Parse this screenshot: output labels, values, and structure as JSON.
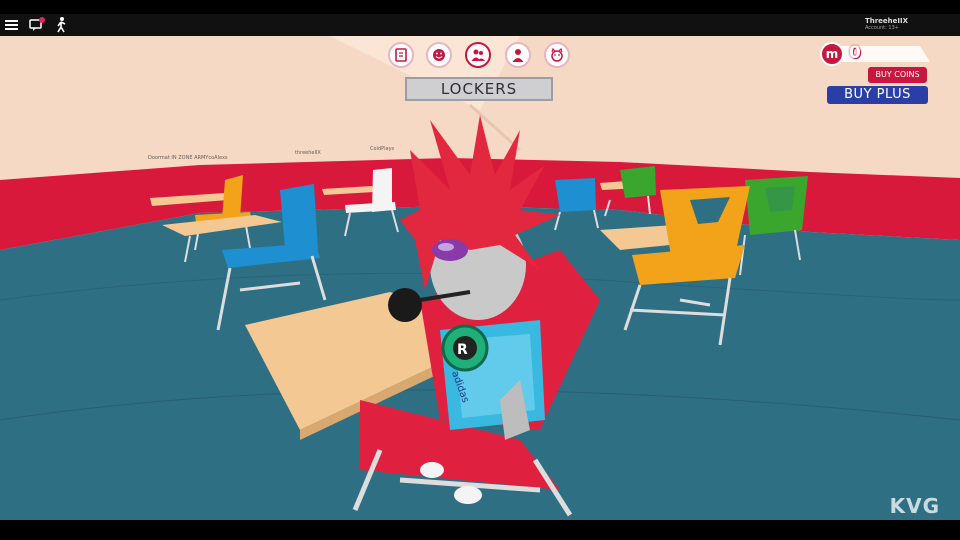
{
  "user": {
    "name": "ThreeheIIX",
    "account": "Account: 13+"
  },
  "topbar": {
    "icons": [
      "hamburger-menu-icon",
      "chat-icon",
      "emote-icon"
    ],
    "chat_badge_color": "#e0245e"
  },
  "hud": {
    "icons": [
      "lockers-icon",
      "emoji-icon",
      "friends-icon",
      "avatar-icon",
      "pets-icon"
    ],
    "lockers_label": "LOCKERS",
    "coin_symbol": "m",
    "coin_count": "0",
    "buy_coins_label": "BUY COINS",
    "buy_plus_label": "BUY PLUS"
  },
  "nametags": [
    "Doormat IN ZONE ARMYcoAlexs",
    "threeheIIX",
    "ColdPlays"
  ],
  "watermark": "KVG",
  "colors": {
    "wall": "#f6d9c4",
    "wall_stripe": "#d8193c",
    "floor": "#2f6f84",
    "chair_red": "#e0203f",
    "chair_blue": "#1e8fd0",
    "chair_orange": "#f2a31a",
    "chair_green": "#3aa62e",
    "desk": "#f3c893",
    "brand_red": "#c8173f",
    "brand_blue": "#2a3ea8"
  }
}
